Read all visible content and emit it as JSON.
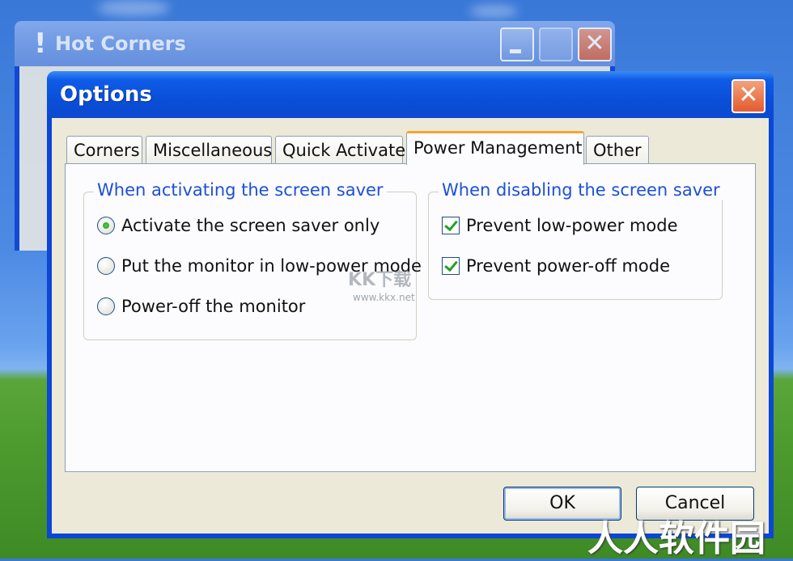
{
  "background_window": {
    "title": "Hot Corners",
    "icon_glyph": "!",
    "close_glyph": "✕"
  },
  "dialog": {
    "title": "Options",
    "close_glyph": "✕",
    "tabs": [
      {
        "label": "Corners",
        "active": false
      },
      {
        "label": "Miscellaneous",
        "active": false
      },
      {
        "label": "Quick Activate",
        "active": false
      },
      {
        "label": "Power Management",
        "active": true
      },
      {
        "label": "Other",
        "active": false
      }
    ],
    "activating_group": {
      "legend": "When activating the screen saver",
      "options": [
        {
          "label": "Activate the screen saver only",
          "selected": true
        },
        {
          "label": "Put the monitor in low-power mode",
          "selected": false
        },
        {
          "label": "Power-off the monitor",
          "selected": false
        }
      ]
    },
    "disabling_group": {
      "legend": "When disabling the screen saver",
      "options": [
        {
          "label": "Prevent low-power mode",
          "checked": true
        },
        {
          "label": "Prevent power-off mode",
          "checked": true
        }
      ]
    },
    "ok_label": "OK",
    "cancel_label": "Cancel"
  },
  "watermarks": {
    "kkx_logo": "KK下载",
    "kkx_url": "www.kkx.net",
    "rrsoft": "人人软件园"
  },
  "colors": {
    "titlebar_blue": "#0a4fd8",
    "legend_blue": "#1d4fd8",
    "active_tab_accent": "#f4a532",
    "check_green": "#21a121"
  }
}
